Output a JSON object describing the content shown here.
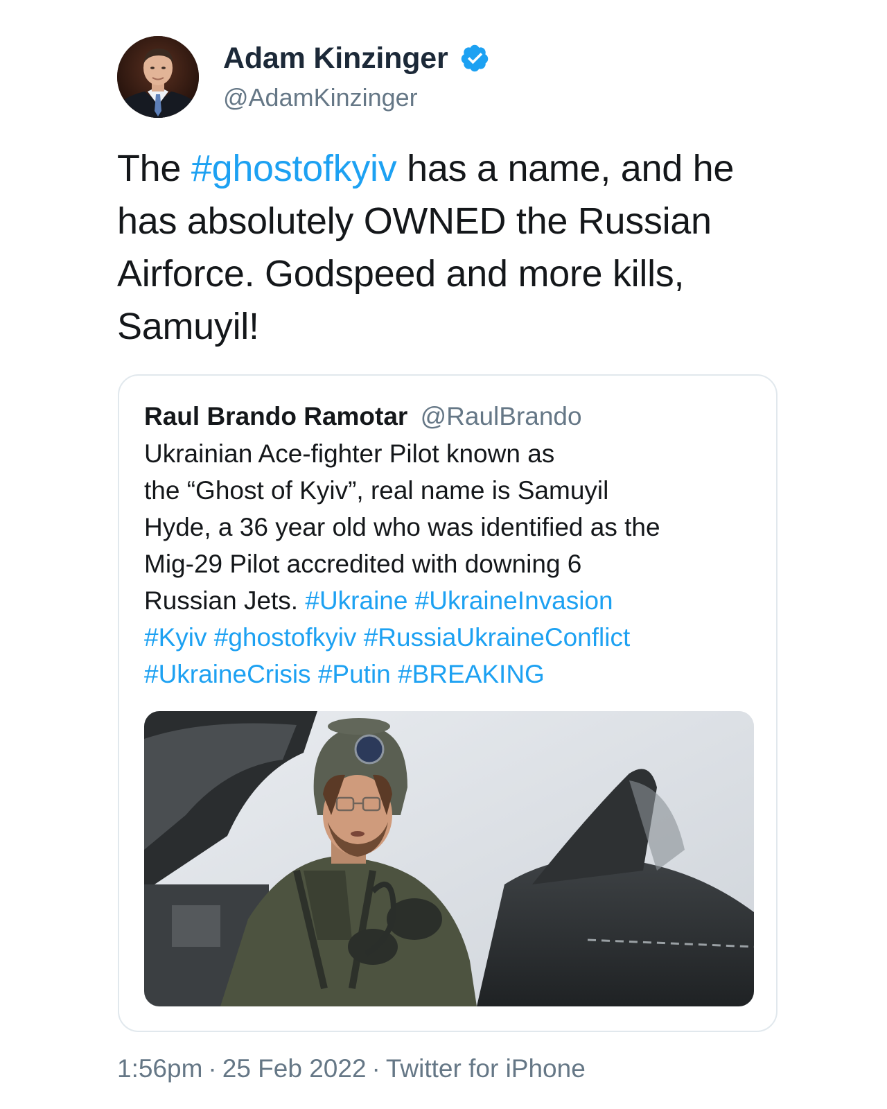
{
  "author": {
    "display_name": "Adam Kinzinger",
    "handle": "@AdamKinzinger",
    "verified": true
  },
  "tweet": {
    "segments": [
      {
        "type": "text",
        "value": "The "
      },
      {
        "type": "hashtag",
        "value": "#ghostofkyiv"
      },
      {
        "type": "text",
        "value": " has a name, and he has absolutely OWNED the Russian Airforce.  Godspeed and more kills, Samuyil!"
      }
    ]
  },
  "quoted_tweet": {
    "display_name": "Raul Brando Ramotar",
    "handle": "@RaulBrando",
    "lines": [
      [
        {
          "type": "text",
          "value": "Ukrainian Ace-fighter Pilot known as"
        }
      ],
      [
        {
          "type": "text",
          "value": "the “Ghost of Kyiv”, real name is Samuyil"
        }
      ],
      [
        {
          "type": "text",
          "value": "Hyde, a 36 year old who was identified as the"
        }
      ],
      [
        {
          "type": "text",
          "value": "Mig-29 Pilot accredited with downing 6"
        }
      ],
      [
        {
          "type": "text",
          "value": "Russian Jets. "
        },
        {
          "type": "hashtag",
          "value": "#Ukraine"
        },
        {
          "type": "text",
          "value": " "
        },
        {
          "type": "hashtag",
          "value": "#UkraineInvasion"
        }
      ],
      [
        {
          "type": "hashtag",
          "value": "#Kyiv"
        },
        {
          "type": "text",
          "value": " "
        },
        {
          "type": "hashtag",
          "value": "#ghostofkyiv"
        },
        {
          "type": "text",
          "value": " "
        },
        {
          "type": "hashtag",
          "value": "#RussiaUkraineConflict"
        }
      ],
      [
        {
          "type": "hashtag",
          "value": "#UkraineCrisis"
        },
        {
          "type": "text",
          "value": " "
        },
        {
          "type": "hashtag",
          "value": "#Putin"
        },
        {
          "type": "text",
          "value": " "
        },
        {
          "type": "hashtag",
          "value": "#BREAKING"
        }
      ]
    ]
  },
  "meta": {
    "time": "1:56pm",
    "separator": "·",
    "date": "25 Feb 2022",
    "source": "Twitter for iPhone"
  },
  "colors": {
    "link": "#1da1f2",
    "text": "#14171a",
    "secondary": "#657786",
    "border": "#e1e8ed",
    "verified": "#1da1f2"
  },
  "icons": {
    "verified": "verified-badge-icon"
  }
}
